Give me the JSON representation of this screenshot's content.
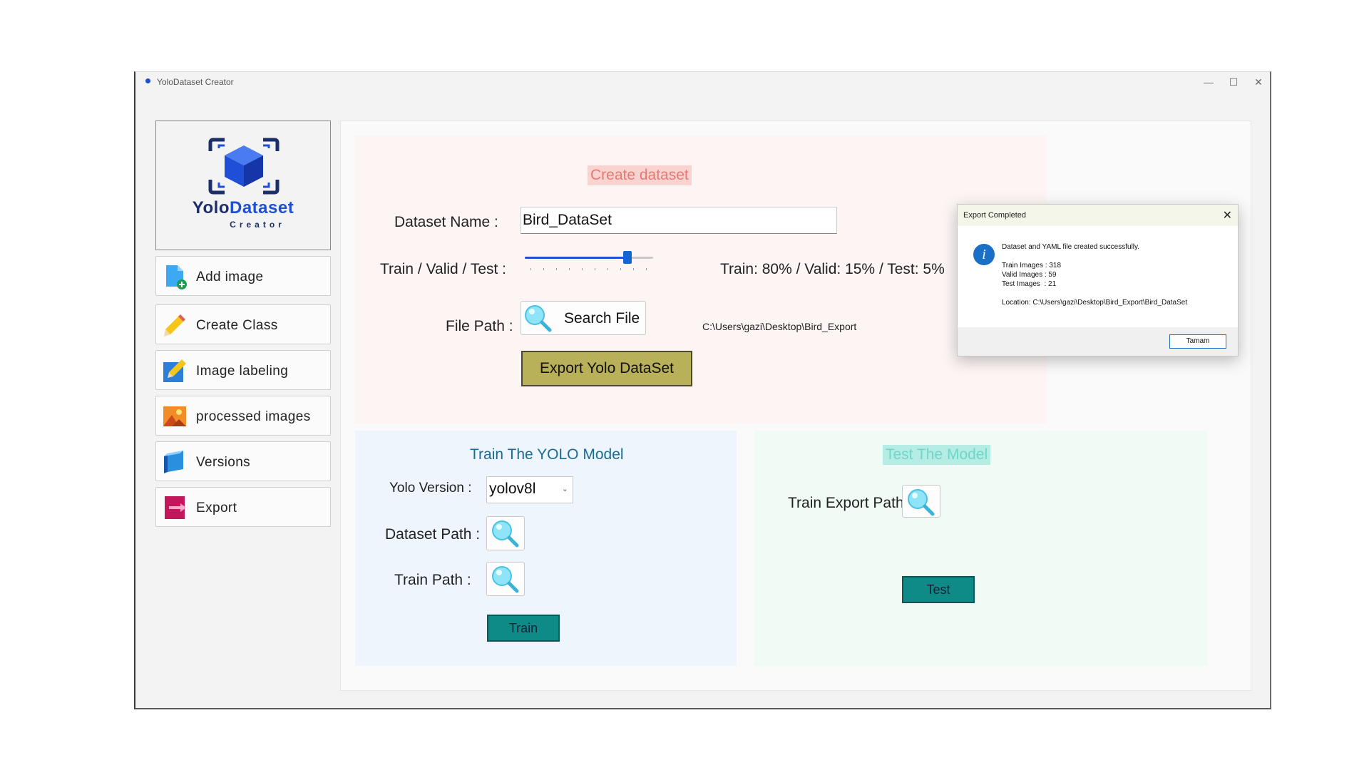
{
  "window": {
    "title": "YoloDataset Creator",
    "controls": {
      "minimize": "—",
      "maximize": "☐",
      "close": "✕"
    }
  },
  "logo": {
    "word_main": "Yolo",
    "word_accent": "Dataset",
    "sub": "Creator"
  },
  "sidebar": {
    "items": [
      {
        "label": "Add image",
        "icon": "add-image-icon"
      },
      {
        "label": "Create Class",
        "icon": "pencil-icon"
      },
      {
        "label": "Image labeling",
        "icon": "labeling-icon"
      },
      {
        "label": "processed images",
        "icon": "picture-icon"
      },
      {
        "label": "Versions",
        "icon": "cube-icon"
      },
      {
        "label": "Export",
        "icon": "export-icon"
      }
    ]
  },
  "create": {
    "title": "Create dataset",
    "dataset_name_label": "Dataset Name :",
    "dataset_name_value": "Bird_DataSet",
    "split_label": "Train / Valid / Test :",
    "split_value": 0.8,
    "split_text": "Train: 80% / Valid: 15% / Test: 5%",
    "file_path_label": "File Path :",
    "search_label": "Search File",
    "file_path_value": "C:\\Users\\gazi\\Desktop\\Bird_Export",
    "export_label": "Export Yolo DataSet"
  },
  "train": {
    "title": "Train The YOLO Model",
    "version_label": "Yolo Version :",
    "version_value": "yolov8l",
    "dataset_path_label": "Dataset Path :",
    "train_path_label": "Train Path :",
    "train_button": "Train"
  },
  "test": {
    "title": "Test The Model",
    "export_path_label": "Train Export Path :",
    "test_button": "Test"
  },
  "dialog": {
    "title": "Export Completed",
    "message": "Dataset and YAML file created successfully.",
    "train_images": "Train Images : 318",
    "valid_images": "Valid Images : 59",
    "test_images": "Test Images  : 21",
    "location": "Location: C:\\Users\\gazi\\Desktop\\Bird_Export\\Bird_DataSet",
    "ok_button": "Tamam",
    "close": "✕"
  },
  "colors": {
    "accent_blue": "#1f4fd6",
    "export_button": "#b9b05a",
    "teal_button": "#0e8a87",
    "create_title_bg": "#f9d3d0",
    "test_title_bg": "#b5ece4"
  }
}
